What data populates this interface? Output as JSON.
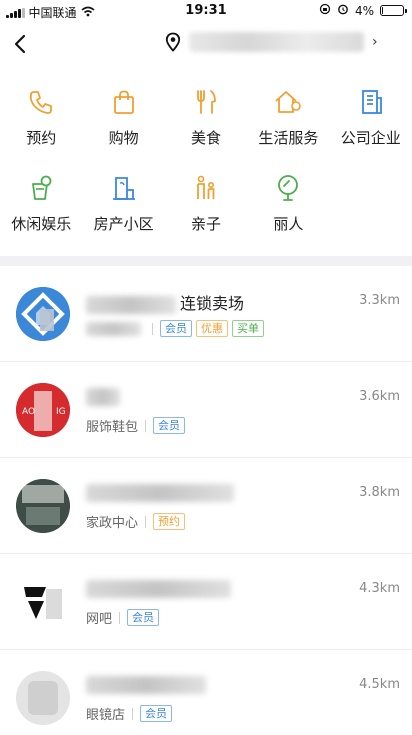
{
  "status_bar": {
    "carrier": "中国联通",
    "time": "19:31",
    "battery_text": "4%",
    "battery_level": 0.04,
    "icons": [
      "signal-icon",
      "wifi-icon",
      "lock-rotation-icon",
      "alarm-icon",
      "battery-icon"
    ]
  },
  "nav": {
    "back_icon": "chevron-left-icon",
    "location_icon": "location-pin-icon",
    "forward_icon": "chevron-right-icon",
    "forward_glyph": "›"
  },
  "categories": [
    {
      "label": "预约",
      "icon": "phone-icon",
      "color": "#f0a030"
    },
    {
      "label": "购物",
      "icon": "shopping-bag-icon",
      "color": "#f0a030"
    },
    {
      "label": "美食",
      "icon": "fork-knife-icon",
      "color": "#f0a030"
    },
    {
      "label": "生活服务",
      "icon": "house-icon",
      "color": "#f0a030"
    },
    {
      "label": "公司企业",
      "icon": "building-icon",
      "color": "#3b87e0"
    },
    {
      "label": "休闲娱乐",
      "icon": "drink-icon",
      "color": "#4cae4c"
    },
    {
      "label": "房产小区",
      "icon": "property-icon",
      "color": "#3b87e0"
    },
    {
      "label": "亲子",
      "icon": "parent-child-icon",
      "color": "#f0a030"
    },
    {
      "label": "丽人",
      "icon": "mirror-icon",
      "color": "#4cae4c"
    }
  ],
  "shops": [
    {
      "name_visible": "连锁卖场",
      "category": "",
      "distance": "3.3km",
      "tags": [
        "会员",
        "优惠",
        "买单"
      ]
    },
    {
      "name_visible": "",
      "category": "服饰鞋包",
      "distance": "3.6km",
      "tags": [
        "会员"
      ]
    },
    {
      "name_visible": "",
      "category": "家政中心",
      "distance": "3.8km",
      "tags": [
        "预约"
      ]
    },
    {
      "name_visible": "",
      "category": "网吧",
      "distance": "4.3km",
      "tags": [
        "会员"
      ]
    },
    {
      "name_visible": "",
      "category": "眼镜店",
      "distance": "4.5km",
      "tags": [
        "会员"
      ]
    }
  ]
}
